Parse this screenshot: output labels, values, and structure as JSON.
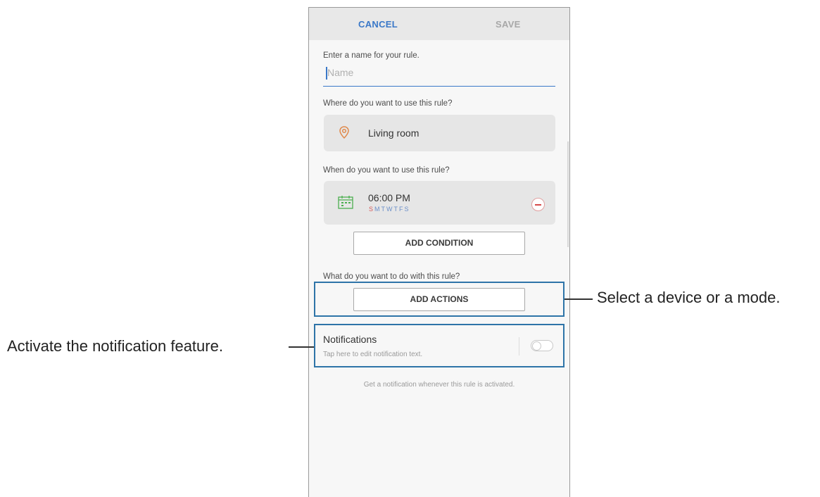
{
  "header": {
    "cancel_label": "CANCEL",
    "save_label": "SAVE"
  },
  "name_section": {
    "prompt": "Enter a name for your rule.",
    "placeholder": "Name",
    "value": ""
  },
  "where_section": {
    "prompt": "Where do you want to use this rule?",
    "location": "Living room"
  },
  "when_section": {
    "prompt": "When do you want to use this rule?",
    "time": "06:00 PM",
    "days": [
      "S",
      "M",
      "T",
      "W",
      "T",
      "F",
      "S"
    ]
  },
  "add_condition_label": "ADD CONDITION",
  "actions_section": {
    "prompt": "What do you want to do with this rule?",
    "add_actions_label": "ADD ACTIONS"
  },
  "notifications": {
    "title": "Notifications",
    "subtitle": "Tap here to edit notification text.",
    "enabled": false,
    "hint": "Get a notification whenever this rule is activated."
  },
  "callouts": {
    "actions": "Select a device or a mode.",
    "notifications": "Activate the notification feature."
  },
  "colors": {
    "accent": "#3a78c8",
    "highlight": "#2e74a8",
    "sunday": "#d65a5a"
  },
  "icons": {
    "location": "location-pin-icon",
    "calendar": "calendar-icon",
    "remove": "minus-circle-icon"
  }
}
